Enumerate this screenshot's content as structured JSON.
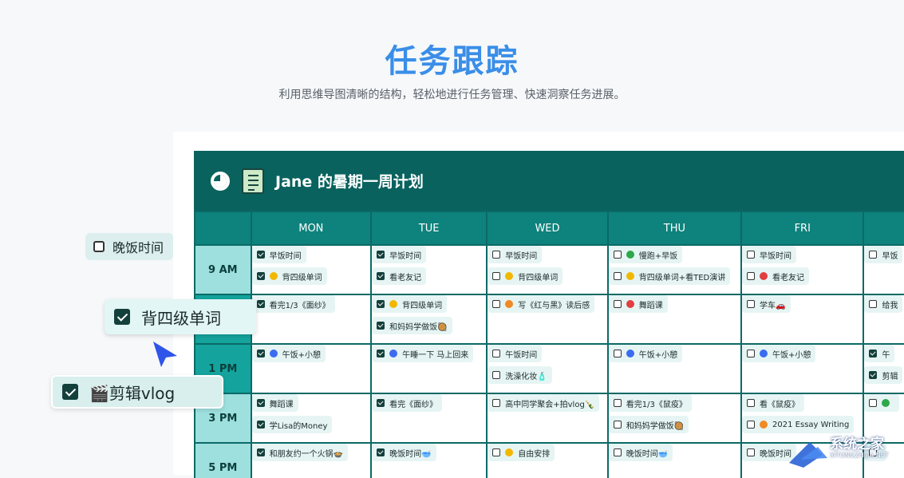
{
  "hero": {
    "title": "任务跟踪",
    "subtitle": "利用思维导图清晰的结构，轻松地进行任务管理、快速洞察任务进展。"
  },
  "board": {
    "title": "Jane 的暑期一周计划",
    "days": [
      "MON",
      "TUE",
      "WED",
      "THU",
      "FRI",
      ""
    ],
    "rows": [
      {
        "time": "9 AM",
        "cells": [
          [
            {
              "t": "早饭时间",
              "c": true,
              "i": ""
            },
            {
              "t": "背四级单词",
              "c": true,
              "i": "#f2b800"
            }
          ],
          [
            {
              "t": "早饭时间",
              "c": true,
              "i": ""
            },
            {
              "t": "看老友记",
              "c": true,
              "i": ""
            }
          ],
          [
            {
              "t": "早饭时间",
              "c": false,
              "i": ""
            },
            {
              "t": "背四级单词",
              "c": false,
              "i": "#f2b800"
            }
          ],
          [
            {
              "t": "慢跑+早饭",
              "c": false,
              "i": "#2ea84a"
            },
            {
              "t": "背四级单词+看TED演讲",
              "c": false,
              "i": "#f2b800"
            }
          ],
          [
            {
              "t": "早饭时间",
              "c": false,
              "i": ""
            },
            {
              "t": "看老友记",
              "c": false,
              "i": "#e04040"
            }
          ],
          [
            {
              "t": "早饭",
              "c": false,
              "i": ""
            }
          ]
        ]
      },
      {
        "time": "",
        "cells": [
          [
            {
              "t": "看完1/3《面纱》",
              "c": true,
              "i": ""
            }
          ],
          [
            {
              "t": "背四级单词",
              "c": true,
              "i": "#f2b800"
            },
            {
              "t": "和妈妈学做饭🥘",
              "c": true,
              "i": ""
            }
          ],
          [
            {
              "t": "写《红与黑》读后感",
              "c": false,
              "i": "#f08a24"
            }
          ],
          [
            {
              "t": "舞蹈课",
              "c": false,
              "i": "#e04040"
            }
          ],
          [
            {
              "t": "学车🚗",
              "c": false,
              "i": ""
            }
          ],
          [
            {
              "t": "给我",
              "c": false,
              "i": ""
            }
          ]
        ]
      },
      {
        "time": "1 PM",
        "cells": [
          [
            {
              "t": "午饭+小憩",
              "c": true,
              "i": "#3b6cf0"
            }
          ],
          [
            {
              "t": "午睡一下 马上回来",
              "c": true,
              "i": "#3b6cf0"
            }
          ],
          [
            {
              "t": "午饭时间",
              "c": false,
              "i": ""
            },
            {
              "t": "洗澡化妆🧴",
              "c": false,
              "i": ""
            }
          ],
          [
            {
              "t": "午饭+小憩",
              "c": false,
              "i": "#3b6cf0"
            }
          ],
          [
            {
              "t": "午饭+小憩",
              "c": false,
              "i": "#3b6cf0"
            }
          ],
          [
            {
              "t": "午",
              "c": true,
              "i": ""
            },
            {
              "t": "剪辑",
              "c": true,
              "i": ""
            }
          ]
        ]
      },
      {
        "time": "3 PM",
        "cells": [
          [
            {
              "t": "舞蹈课",
              "c": true,
              "i": ""
            },
            {
              "t": "学Lisa的Money",
              "c": true,
              "i": ""
            }
          ],
          [
            {
              "t": "看完《面纱》",
              "c": true,
              "i": ""
            }
          ],
          [
            {
              "t": "高中同学聚会+拍vlog🍾",
              "c": false,
              "i": ""
            }
          ],
          [
            {
              "t": "看完1/3《鼠疫》",
              "c": false,
              "i": ""
            },
            {
              "t": "和妈妈学做饭🥘",
              "c": false,
              "i": ""
            }
          ],
          [
            {
              "t": "看《鼠疫》",
              "c": false,
              "i": ""
            },
            {
              "t": "2021 Essay Writing",
              "c": false,
              "i": "#f08a24"
            }
          ],
          [
            {
              "t": "",
              "c": false,
              "i": "#2ea84a"
            }
          ]
        ]
      },
      {
        "time": "5 PM",
        "cells": [
          [
            {
              "t": "和朋友约一个火锅🍲",
              "c": true,
              "i": ""
            }
          ],
          [
            {
              "t": "晚饭时间🥣",
              "c": true,
              "i": ""
            }
          ],
          [
            {
              "t": "自由安排",
              "c": false,
              "i": "#f2b800"
            }
          ],
          [
            {
              "t": "晚饭时间🥣",
              "c": false,
              "i": ""
            }
          ],
          [
            {
              "t": "晚饭时间",
              "c": false,
              "i": ""
            }
          ],
          [
            {
              "t": "",
              "c": false,
              "i": ""
            }
          ]
        ]
      }
    ]
  },
  "floating": {
    "dinner": "晚饭时间",
    "vocab": "背四级单词",
    "edit": "🎬剪辑vlog"
  },
  "watermark": {
    "name": "系统之家",
    "site": "XITONGZHIJIA.NET"
  }
}
